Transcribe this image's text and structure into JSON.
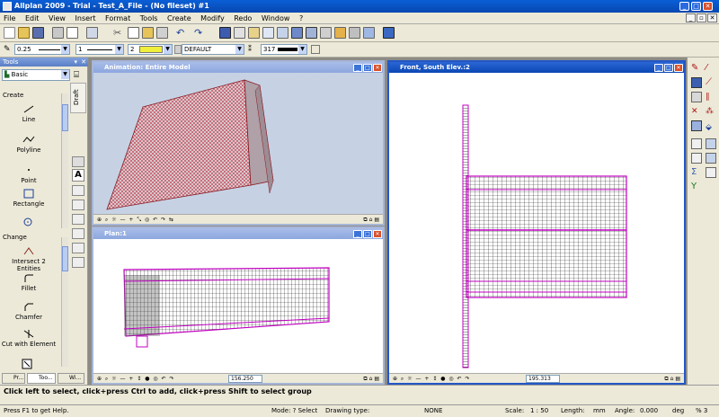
{
  "app": {
    "title": "Allplan 2009 - Trial - Test_A_File - (No fileset) #1"
  },
  "menu": [
    "File",
    "Edit",
    "View",
    "Insert",
    "Format",
    "Tools",
    "Create",
    "Modify",
    "Redo",
    "Window",
    "?"
  ],
  "toolbar2": {
    "pen_value": "0.25",
    "line_value": "1",
    "color_value": "2",
    "layer_value": "DEFAULT",
    "pattern_value": "317"
  },
  "palette": {
    "header": "Tools",
    "family": "Basic",
    "draft_tab": "Draft",
    "create_label": "Create",
    "create_items": [
      "Line",
      "Polyline",
      "Point",
      "Rectangle"
    ],
    "change_label": "Change",
    "change_items": [
      "Intersect 2 Entities",
      "Fillet",
      "Chamfer",
      "Cut with Element"
    ],
    "tabs": [
      "Pr...",
      "Too...",
      "Wi..."
    ]
  },
  "windows": {
    "animation": {
      "title": "Animation: Entire Model"
    },
    "plan": {
      "title": "Plan:1",
      "scale_value": "156.250"
    },
    "front": {
      "title": "Front, South Elev.:2",
      "scale_value": "195.313"
    }
  },
  "prompt": "Click left to select, click+press Ctrl to add, click+press Shift to select group",
  "status": {
    "help": "Press F1 to get Help.",
    "mode": "Mode: ? Select",
    "drawing_type": "Drawing type:",
    "none": "NONE",
    "scale": "Scale:",
    "scale_value": "1 : 50",
    "length": "Length:",
    "length_unit": "mm",
    "angle": "Angle:",
    "angle_value": "0.000",
    "deg": "deg",
    "pct": "% 3"
  },
  "colors": {
    "accent": "#0a5fd6",
    "model_edges": "#b5192c",
    "selection": "#c000c0",
    "viewport_bg": "#c6d2e4"
  }
}
